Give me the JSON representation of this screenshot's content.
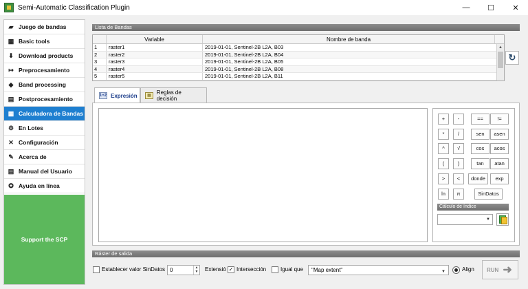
{
  "window": {
    "title": "Semi-Automatic Classification Plugin",
    "minimize": "—",
    "maximize": "☐",
    "close": "✕"
  },
  "sidebar": {
    "items": [
      {
        "label": "Juego de bandas",
        "icon": "▰"
      },
      {
        "label": "Basic tools",
        "icon": "▦"
      },
      {
        "label": "Download products",
        "icon": "⬇"
      },
      {
        "label": "Preprocesamiento",
        "icon": "↦"
      },
      {
        "label": "Band processing",
        "icon": "◆"
      },
      {
        "label": "Postprocesamiento",
        "icon": "▤"
      },
      {
        "label": "Calculadora de Bandas",
        "icon": "▦"
      },
      {
        "label": "En Lotes",
        "icon": "⚙"
      },
      {
        "label": "Configuración",
        "icon": "✕"
      },
      {
        "label": "Acerca de",
        "icon": "✎"
      },
      {
        "label": "Manual del Usuario",
        "icon": "▤"
      },
      {
        "label": "Ayuda en línea",
        "icon": "✪"
      }
    ],
    "active_index": 6,
    "support_label": "Support the SCP"
  },
  "band_list": {
    "header": "Lista de Bandas",
    "columns": [
      "Variable",
      "Nombre de banda"
    ],
    "rows": [
      {
        "num": "1",
        "variable": "raster1",
        "name": "2019-01-01, Sentinel-2B L2A, B03"
      },
      {
        "num": "2",
        "variable": "raster2",
        "name": "2019-01-01, Sentinel-2B L2A, B04"
      },
      {
        "num": "3",
        "variable": "raster3",
        "name": "2019-01-01, Sentinel-2B L2A, B05"
      },
      {
        "num": "4",
        "variable": "raster4",
        "name": "2019-01-01, Sentinel-2B L2A, B08"
      },
      {
        "num": "5",
        "variable": "raster5",
        "name": "2019-01-01, Sentinel-2B L2A, B11"
      }
    ],
    "reload_icon": "↻"
  },
  "tabs": [
    {
      "label": "Expresión",
      "icon": "1+2"
    },
    {
      "label": "Reglas de decisión",
      "icon": "▦"
    }
  ],
  "calculator": {
    "keys": [
      [
        "+",
        "-",
        "==",
        "!="
      ],
      [
        "*",
        "/",
        "sen",
        "asen"
      ],
      [
        "^",
        "√",
        "cos",
        "acos"
      ],
      [
        "(",
        ")",
        "tan",
        "atan"
      ],
      [
        ">",
        "<",
        "donde",
        "exp"
      ],
      [
        "ln",
        "π",
        "SinDatos"
      ]
    ],
    "index_header": "Cálculo de índice",
    "index_value": ""
  },
  "output": {
    "header": "Ráster de salida",
    "nodata_label": "Establecer valor SinDatos",
    "nodata_checked": false,
    "nodata_value": "0",
    "extent_label": "Extensió",
    "intersection_label": "Intersección",
    "intersection_checked": true,
    "same_as_label": "Igual que",
    "same_as_checked": false,
    "extent_value": "\"Map extent\"",
    "align_label": "Align",
    "align_selected": true,
    "run_label": "RUN"
  }
}
